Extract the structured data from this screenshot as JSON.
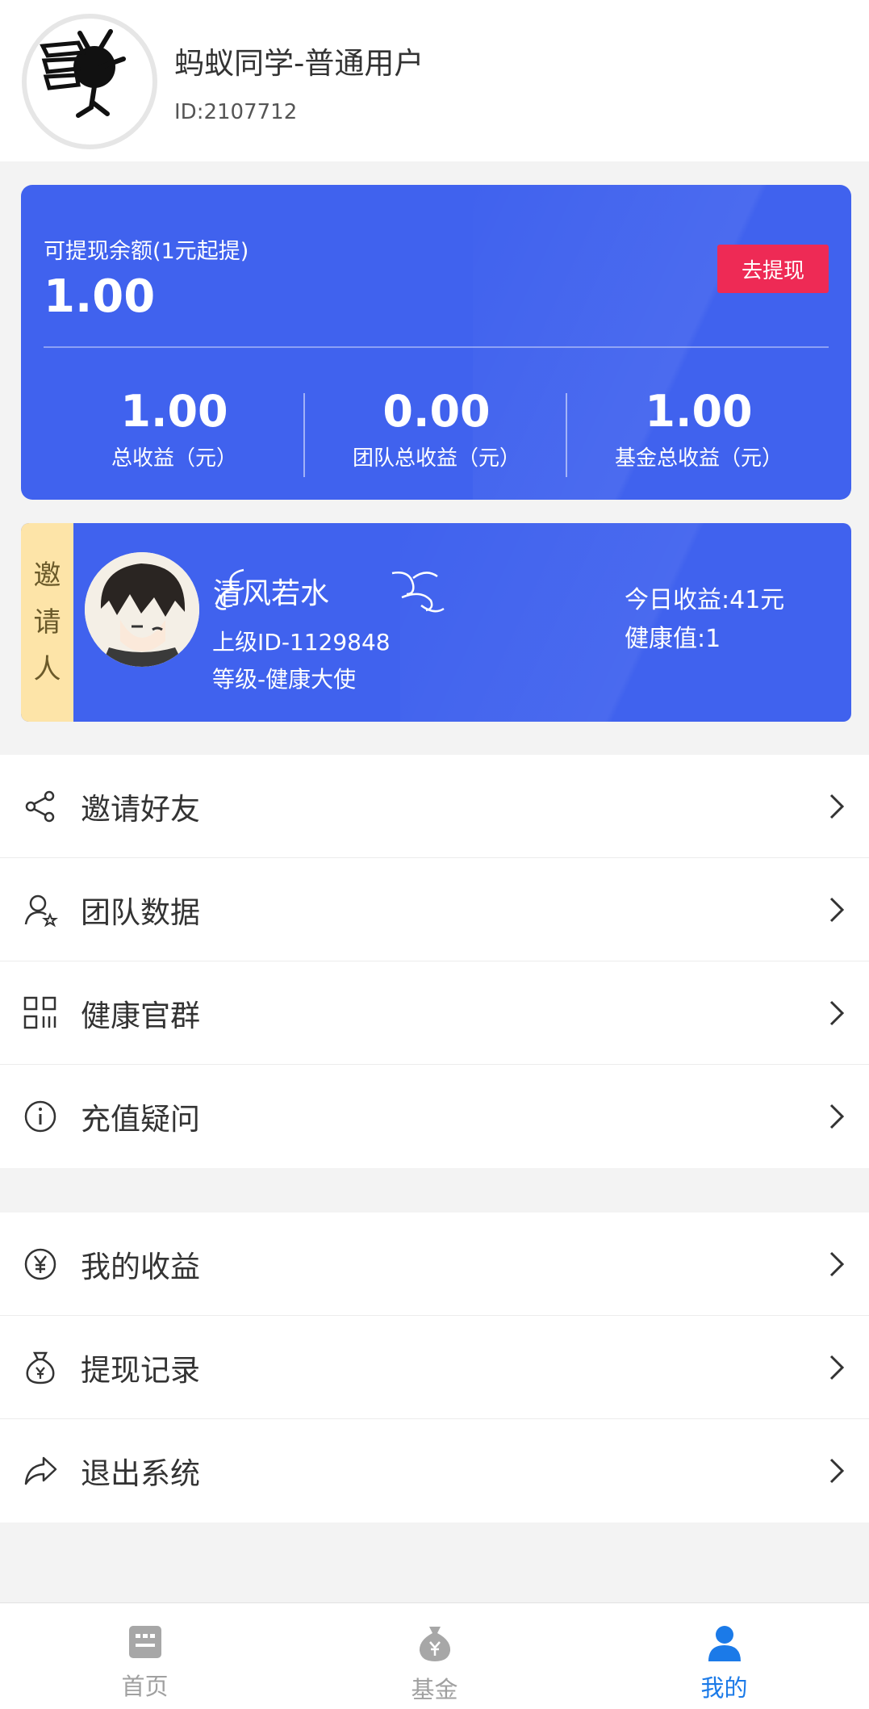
{
  "user": {
    "name": "蚂蚁同学-普通用户",
    "id": "ID:2107712"
  },
  "balance": {
    "label": "可提现余额(1元起提)",
    "value": "1.00",
    "withdraw_button": "去提现",
    "stats": [
      {
        "value": "1.00",
        "label": "总收益（元）"
      },
      {
        "value": "0.00",
        "label": "团队总收益（元）"
      },
      {
        "value": "1.00",
        "label": "基金总收益（元）"
      }
    ]
  },
  "inviter": {
    "tag": [
      "邀",
      "请",
      "人"
    ],
    "name": "清风若水",
    "superior_id": "上级ID-1129848",
    "level": "等级-健康大使",
    "today_earnings": "今日收益:41元",
    "health": "健康值:1"
  },
  "menu_group_1": [
    {
      "label": "邀请好友",
      "icon": "share-icon"
    },
    {
      "label": "团队数据",
      "icon": "user-star-icon"
    },
    {
      "label": "健康官群",
      "icon": "qrcode-icon"
    },
    {
      "label": "充值疑问",
      "icon": "info-icon"
    }
  ],
  "menu_group_2": [
    {
      "label": "我的收益",
      "icon": "yen-circle-icon"
    },
    {
      "label": "提现记录",
      "icon": "money-bag-icon"
    },
    {
      "label": "退出系统",
      "icon": "forward-icon"
    }
  ],
  "tabbar": [
    {
      "label": "首页",
      "icon": "home-icon",
      "active": false
    },
    {
      "label": "基金",
      "icon": "fund-bag-icon",
      "active": false
    },
    {
      "label": "我的",
      "icon": "person-icon",
      "active": true
    }
  ],
  "colors": {
    "card_blue": "#4062ee",
    "withdraw_red": "#ee2a55",
    "tag_yellow": "#fde4a8",
    "active_tab": "#1b7ae8"
  }
}
